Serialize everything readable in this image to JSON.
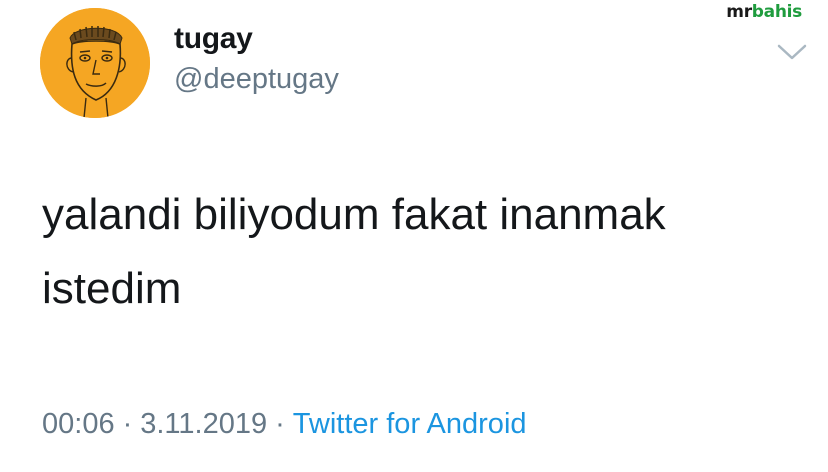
{
  "watermark": {
    "part1": "mr",
    "part2": "bahis"
  },
  "user": {
    "display_name": "tugay",
    "handle": "@deeptugay"
  },
  "tweet": {
    "line1": "yalandi biliyodum fakat inanmak",
    "line2": "istedim"
  },
  "meta": {
    "time": "00:06",
    "date": "3.11.2019",
    "source": "Twitter for Android",
    "separator": "·"
  },
  "colors": {
    "avatar_bg": "#f5a623",
    "link": "#1b95e0",
    "secondary_text": "#657786",
    "primary_text": "#14171a",
    "watermark_accent": "#1f9c3e"
  },
  "icons": {
    "menu": "chevron-down-icon",
    "avatar": "sketched-face-avatar"
  }
}
